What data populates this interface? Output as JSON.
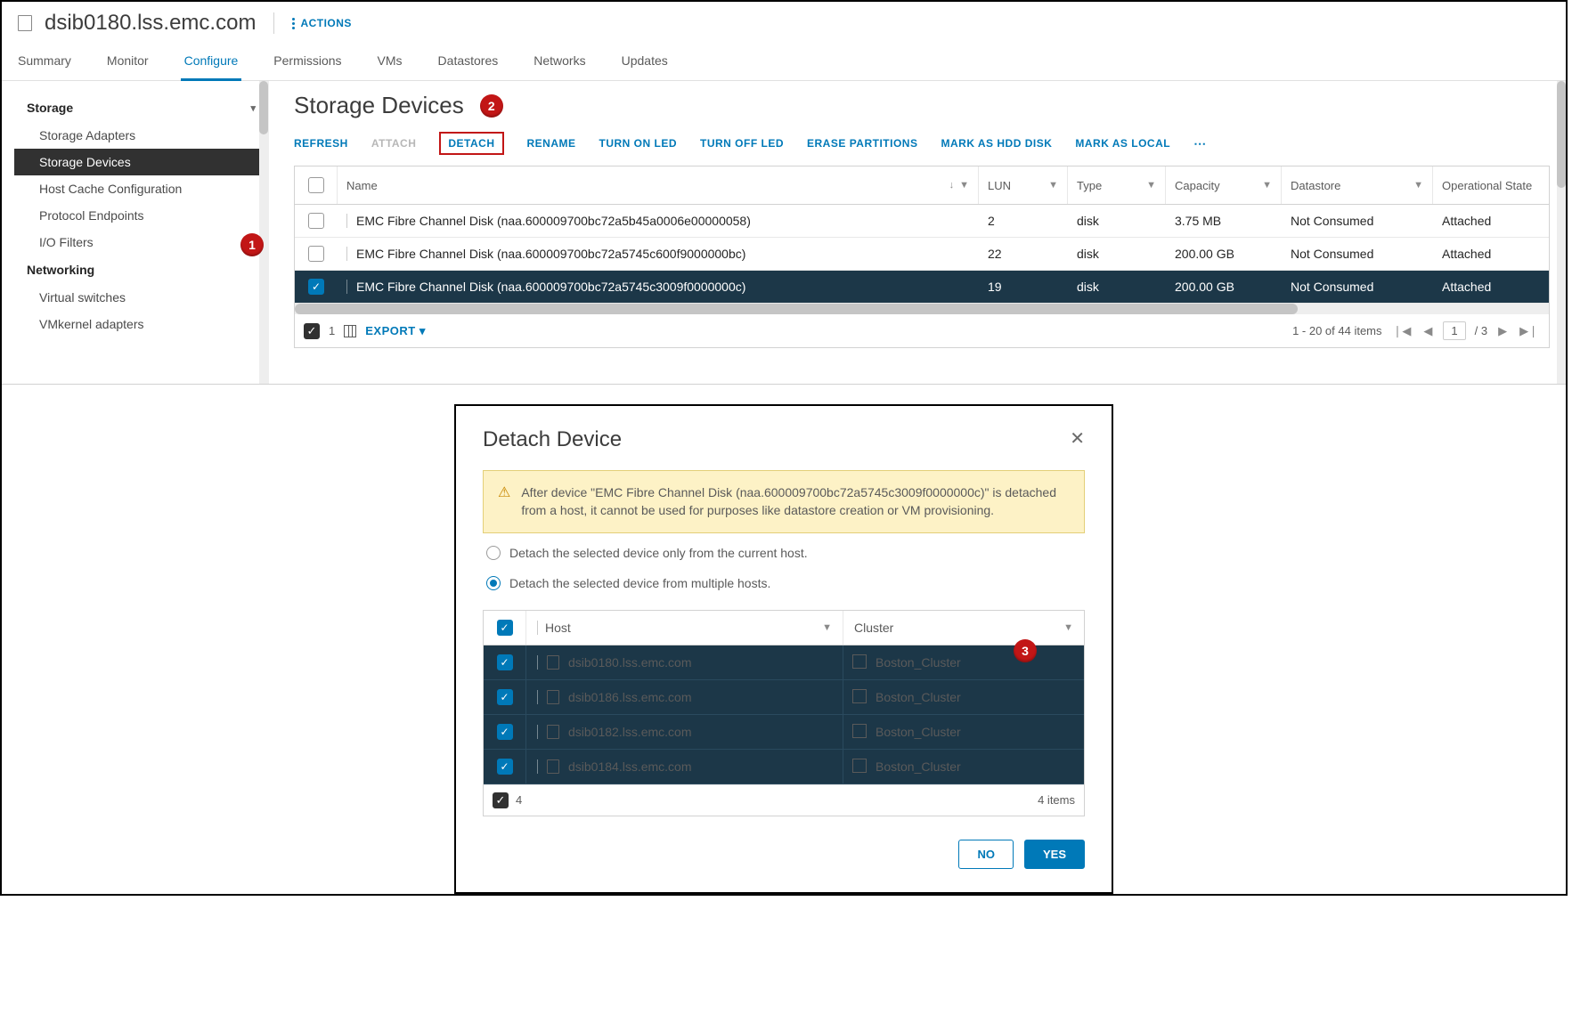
{
  "header": {
    "host": "dsib0180.lss.emc.com",
    "actions_label": "ACTIONS"
  },
  "tabs": [
    "Summary",
    "Monitor",
    "Configure",
    "Permissions",
    "VMs",
    "Datastores",
    "Networks",
    "Updates"
  ],
  "tabs_active_index": 2,
  "sidebar": {
    "groups": [
      {
        "label": "Storage",
        "expanded": true,
        "items": [
          "Storage Adapters",
          "Storage Devices",
          "Host Cache Configuration",
          "Protocol Endpoints",
          "I/O Filters"
        ],
        "active_index": 1
      },
      {
        "label": "Networking",
        "expanded": true,
        "items": [
          "Virtual switches",
          "VMkernel adapters"
        ],
        "active_index": -1
      }
    ]
  },
  "callouts": {
    "one": "1",
    "two": "2",
    "three": "3"
  },
  "main": {
    "title": "Storage Devices",
    "toolbar": {
      "refresh": "REFRESH",
      "attach": "ATTACH",
      "detach": "DETACH",
      "rename": "RENAME",
      "turn_on": "TURN ON LED",
      "turn_off": "TURN OFF LED",
      "erase": "ERASE PARTITIONS",
      "hdd": "MARK AS HDD DISK",
      "local": "MARK AS LOCAL"
    },
    "columns": {
      "name": "Name",
      "lun": "LUN",
      "type": "Type",
      "capacity": "Capacity",
      "datastore": "Datastore",
      "opstate": "Operational State"
    },
    "rows": [
      {
        "sel": false,
        "name": "EMC Fibre Channel Disk (naa.600009700bc72a5b45a0006e00000058)",
        "lun": "2",
        "type": "disk",
        "cap": "3.75 MB",
        "ds": "Not Consumed",
        "os": "Attached"
      },
      {
        "sel": false,
        "name": "EMC Fibre Channel Disk (naa.600009700bc72a5745c600f9000000bc)",
        "lun": "22",
        "type": "disk",
        "cap": "200.00 GB",
        "ds": "Not Consumed",
        "os": "Attached"
      },
      {
        "sel": true,
        "name": "EMC Fibre Channel Disk (naa.600009700bc72a5745c3009f0000000c)",
        "lun": "19",
        "type": "disk",
        "cap": "200.00 GB",
        "ds": "Not Consumed",
        "os": "Attached"
      }
    ],
    "footer": {
      "selected": "1",
      "export": "EXPORT",
      "range": "1 - 20 of 44 items",
      "page": "1",
      "pages": "/ 3"
    }
  },
  "modal": {
    "title": "Detach Device",
    "warning": "After device \"EMC Fibre Channel Disk (naa.600009700bc72a5745c3009f0000000c)\" is detached from a host, it cannot be used for purposes like datastore creation or VM provisioning.",
    "opt1": "Detach the selected device only from the current host.",
    "opt2": "Detach the selected device from multiple hosts.",
    "selected_option": 1,
    "columns": {
      "host": "Host",
      "cluster": "Cluster"
    },
    "hosts": [
      {
        "host": "dsib0180.lss.emc.com",
        "cluster": "Boston_Cluster"
      },
      {
        "host": "dsib0186.lss.emc.com",
        "cluster": "Boston_Cluster"
      },
      {
        "host": "dsib0182.lss.emc.com",
        "cluster": "Boston_Cluster"
      },
      {
        "host": "dsib0184.lss.emc.com",
        "cluster": "Boston_Cluster"
      }
    ],
    "footer": {
      "count": "4",
      "items": "4 items"
    },
    "buttons": {
      "no": "NO",
      "yes": "YES"
    }
  }
}
